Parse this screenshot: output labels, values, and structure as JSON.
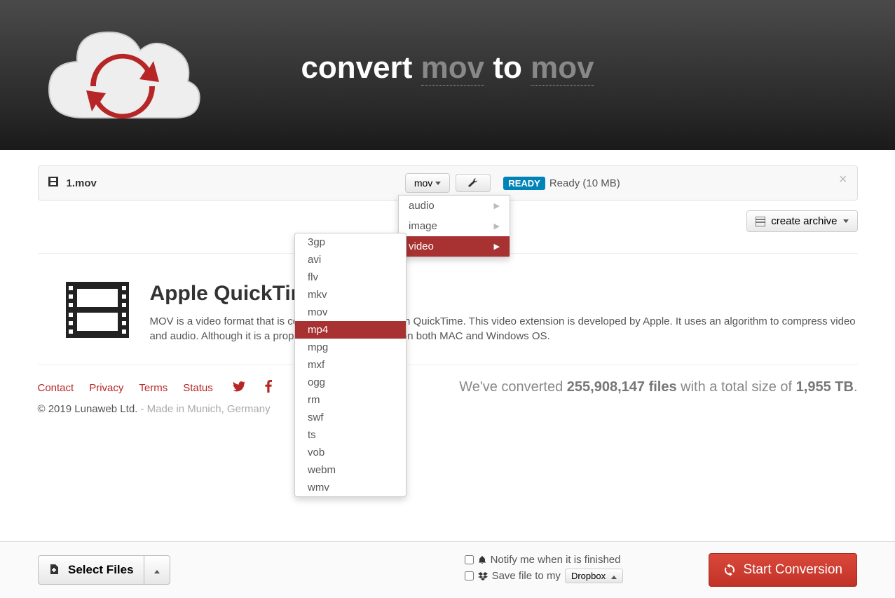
{
  "header": {
    "title_pre": "convert ",
    "from_fmt": "mov",
    "title_mid": " to ",
    "to_fmt": "mov"
  },
  "file_row": {
    "name": "1.mov",
    "format_btn": "mov",
    "status_badge": "READY",
    "status_text": "Ready (10 MB)"
  },
  "archive_btn": "create archive",
  "category_menu": {
    "items": [
      "audio",
      "image",
      "video"
    ],
    "active": "video"
  },
  "format_menu": {
    "items": [
      "3gp",
      "avi",
      "flv",
      "mkv",
      "mov",
      "mp4",
      "mpg",
      "mxf",
      "ogg",
      "rm",
      "swf",
      "ts",
      "vob",
      "webm",
      "wmv"
    ],
    "active": "mp4"
  },
  "info": {
    "heading": "Apple QuickTime Movie",
    "body": "MOV is a video format that is commonly associated with QuickTime. This video extension is developed by Apple. It uses an algorithm to compress video and audio. Although it is a proprietary of Apple, it runs on both MAC and Windows OS."
  },
  "footer": {
    "links": [
      "Contact",
      "Privacy",
      "Terms",
      "Status"
    ],
    "stats_pre": "We've converted ",
    "stats_files": "255,908,147 files",
    "stats_mid": " with a total size of ",
    "stats_size": "1,955 TB",
    "stats_post": ".",
    "copyright": "© 2019 Lunaweb Ltd.",
    "made_in": " - Made in Munich, Germany"
  },
  "bottom": {
    "select_files": "Select Files",
    "notify": "Notify me when it is finished",
    "save_to_my": "Save file to my",
    "dropbox": "Dropbox",
    "start": "Start Conversion"
  }
}
